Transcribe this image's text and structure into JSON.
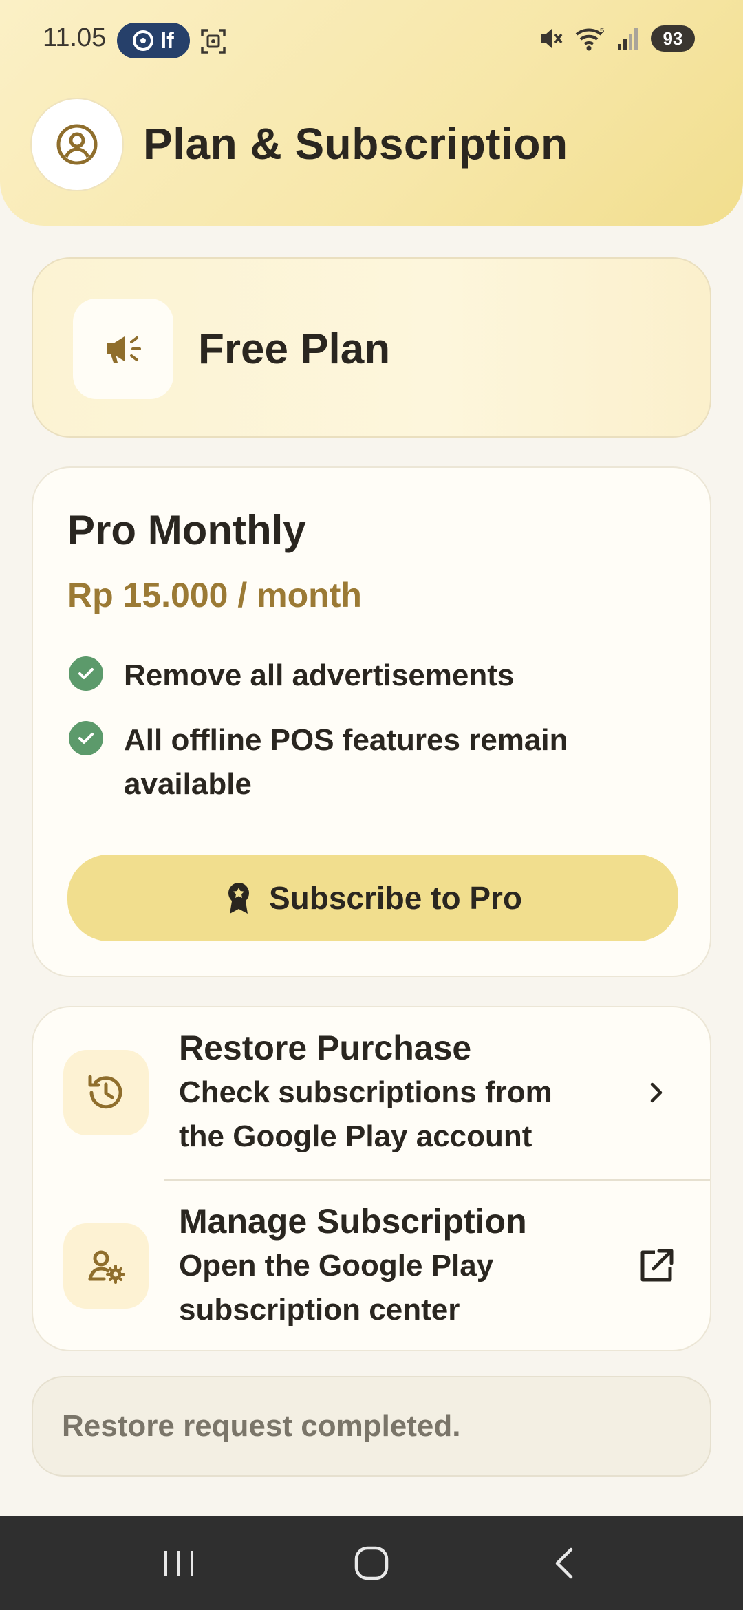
{
  "status_bar": {
    "time": "11.05",
    "pill_label": "lf",
    "battery": "93"
  },
  "header": {
    "title": "Plan & Subscription",
    "avatar_icon": "account-circle-icon"
  },
  "current_plan": {
    "name": "Free Plan",
    "icon": "megaphone-icon"
  },
  "pro_plan": {
    "title": "Pro Monthly",
    "price": "Rp 15.000 / month",
    "features": [
      "Remove all advertisements",
      "All offline POS features remain available"
    ],
    "subscribe_label": "Subscribe to Pro",
    "subscribe_icon": "award-badge-icon"
  },
  "actions": [
    {
      "title": "Restore Purchase",
      "description": "Check subscriptions from the Google Play account",
      "icon": "history-icon",
      "trail_icon": "chevron-right-icon"
    },
    {
      "title": "Manage Subscription",
      "description": "Open the Google Play subscription center",
      "icon": "user-settings-icon",
      "trail_icon": "open-external-icon"
    }
  ],
  "status_message": "Restore request completed.",
  "colors": {
    "header_gradient_start": "#fbf0c6",
    "header_gradient_end": "#f1de8e",
    "accent_price": "#9b7a35",
    "check_green": "#5c9a6b",
    "button_fill": "#f1de8e",
    "nav_bar": "#2f2f2f"
  }
}
